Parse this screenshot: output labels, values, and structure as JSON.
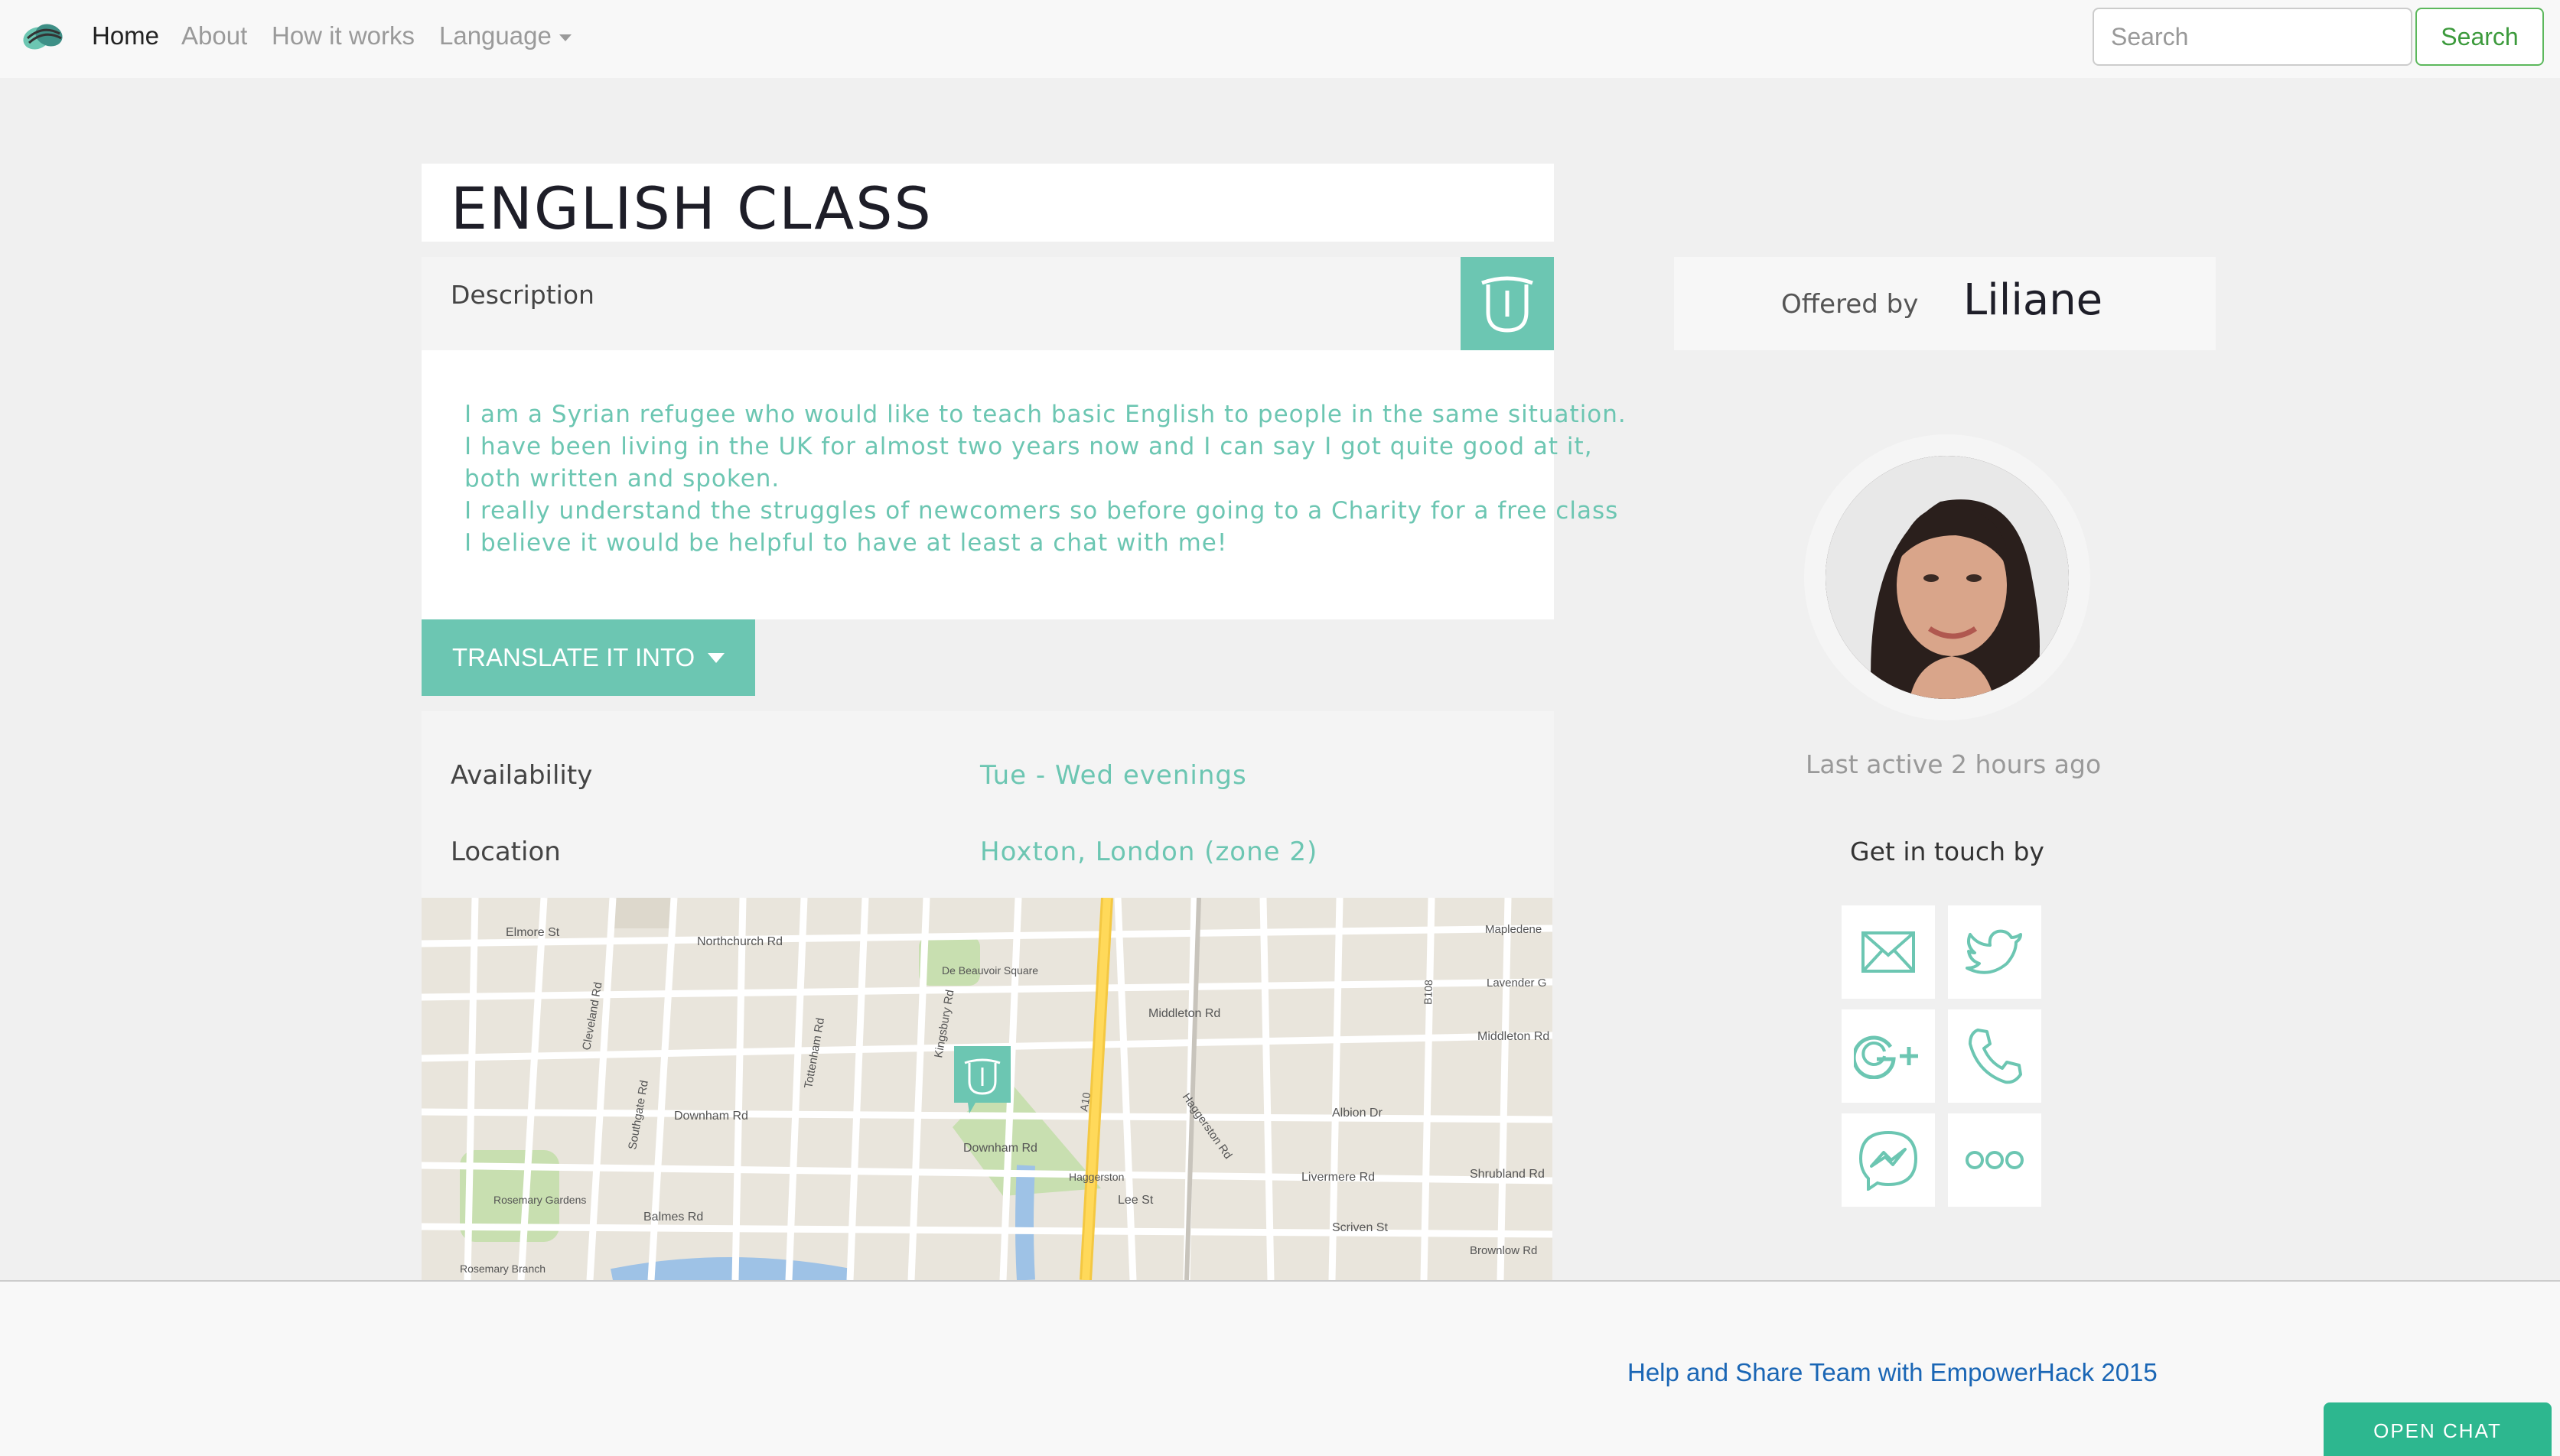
{
  "nav": {
    "items": [
      {
        "label": "Home",
        "active": true
      },
      {
        "label": "About",
        "active": false
      },
      {
        "label": "How it works",
        "active": false
      },
      {
        "label": "Language",
        "active": false
      }
    ],
    "search_placeholder": "Search",
    "search_button": "Search"
  },
  "listing": {
    "title": "ENGLISH CLASS",
    "description_label": "Description",
    "description_lines": [
      "I am a Syrian refugee who would like to teach basic English to people in the same situation.",
      "I have been living in the UK for almost two years now and I can say I got quite good at it,",
      "both written and spoken.",
      "I really understand the struggles of newcomers so before going to a Charity for a free class",
      "I believe it would be helpful to have at least a chat with me!"
    ],
    "translate_button": "TRANSLATE IT INTO",
    "availability_label": "Availability",
    "availability_value": "Tue - Wed evenings",
    "location_label": "Location",
    "location_value": "Hoxton, London (zone 2)"
  },
  "map": {
    "labels": [
      "Elmore St",
      "Northchurch Rd",
      "De Beauvoir Square",
      "Mapledene",
      "Lavender G",
      "Middleton Rd",
      "Middleton Rd",
      "Downham Rd",
      "Downham Rd",
      "Albion Dr",
      "Livermere Rd",
      "Shrubland Rd",
      "Haggerston",
      "Lee St",
      "Scriven St",
      "Balmes Rd",
      "Rosemary Gardens",
      "Rosemary Branch",
      "A10",
      "B108",
      "Brownlow Rd",
      "Haggerston Rd",
      "Cleveland Rd",
      "Southgate Rd",
      "Tottenham Rd",
      "Kingsbury Rd"
    ]
  },
  "profile": {
    "offered_by_label": "Offered by",
    "name": "Liliane",
    "last_active": "Last active 2 hours ago",
    "contact_heading": "Get in touch by",
    "contact_methods": [
      "email-icon",
      "twitter-icon",
      "google-plus-icon",
      "phone-icon",
      "messenger-icon",
      "more-icon"
    ]
  },
  "footer": {
    "link_text": "Help and Share Team with EmpowerHack 2015",
    "chat_button": "OPEN CHAT"
  },
  "colors": {
    "accent": "#6cc6b2",
    "chat_button": "#2db78f",
    "footer_link": "#1a66b5",
    "search_button": "#5cb85c"
  }
}
